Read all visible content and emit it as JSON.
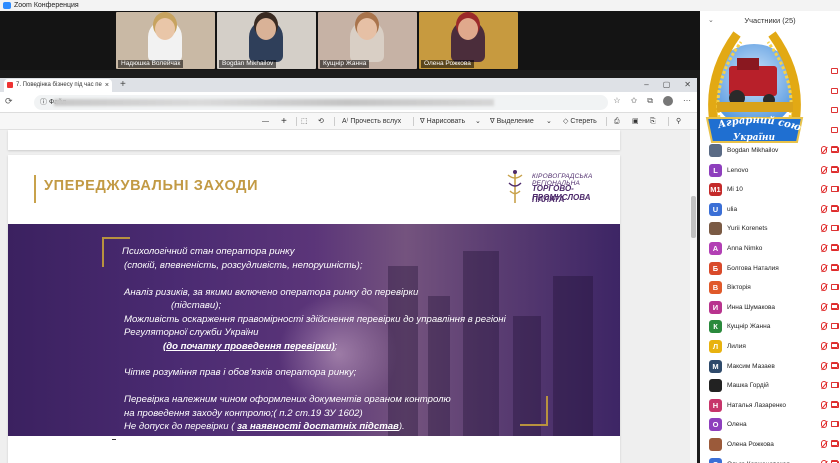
{
  "zoom": {
    "title": "Zoom Конференция"
  },
  "videos": [
    {
      "name": "Надюшка Волейчак",
      "bg": "#c9b9a5",
      "shirt": "#f2f2f2",
      "skin": "#e9c6a8",
      "hair": "#c7a35f"
    },
    {
      "name": "Bogdan Mikhailov",
      "bg": "#d4cfc8",
      "shirt": "#2f3f5a",
      "skin": "#d9b297",
      "hair": "#3a2b22"
    },
    {
      "name": "Кущнір Жанна",
      "bg": "#c6b2a5",
      "shirt": "#d9cfc5",
      "skin": "#e6c0a5",
      "hair": "#a9744c"
    },
    {
      "name": "Олена Рожкова",
      "bg": "#c79a3f",
      "shirt": "#4b2d3b",
      "skin": "#e0a98c",
      "hair": "#9b2a2a"
    }
  ],
  "browser": {
    "tab_title": "7. Поведінка бізнесу під час пе",
    "addr_label": "Файл"
  },
  "pdf_toolbar": {
    "read_aloud": "Прочесть вслух",
    "draw": "Нарисовать",
    "highlight": "Выделение",
    "erase": "Стереть"
  },
  "slide": {
    "heading": "УПЕРЕДЖУВАЛЬНІ ЗАХОДИ",
    "org_line1": "КІРОВОГРАДСЬКА РЕГІОНАЛЬНА",
    "org_line2": "ТОРГОВО-ПРОМИСЛОВА",
    "org_line3": "ПАЛАТА",
    "l1": "Психологічний стан оператора ринку",
    "l2": "(спокій, впевненість, розсудливість, непорушність);",
    "l3": "Аналіз ризиків, за якими включено оператора ринку до перевірки",
    "l4": "(підстави);",
    "l5": "Можливість оскарження правомірності здійснення перевірки до управління в регіоні",
    "l6": "Регуляторної служби України",
    "l7": "(до початку проведення перевірки)",
    "l7_end": ";",
    "l8": "Чітке розуміння прав і обов’язків оператора ринку;",
    "l9": "Перевірка належним чином оформлених документів органом контролю",
    "l10": "на проведення заходу контролю;( п.2 ст.19 ЗУ 1602)",
    "l11": "Не допуск до перевірки ( ",
    "l11_bold": "за наявності достатніх підстав",
    "l11_end": ")."
  },
  "participants": {
    "title": "Участники (25)",
    "list": [
      {
        "name": "Bogdan Mikhailov",
        "initial": "",
        "color": "#5a6b85"
      },
      {
        "name": "Lenovo",
        "initial": "L",
        "color": "#8e3fbd"
      },
      {
        "name": "Mi 10",
        "initial": "M1",
        "color": "#c42a2a"
      },
      {
        "name": "ulia",
        "initial": "U",
        "color": "#3b6fd6"
      },
      {
        "name": "Yurii Korenets",
        "initial": "",
        "color": "#7a5a44"
      },
      {
        "name": "Anna Nimko",
        "initial": "A",
        "color": "#b23fb4"
      },
      {
        "name": "Болгова Наталия",
        "initial": "Б",
        "color": "#d94a2a"
      },
      {
        "name": "Вікторія",
        "initial": "В",
        "color": "#e0592a"
      },
      {
        "name": "Инна Шумакова",
        "initial": "И",
        "color": "#b8338e"
      },
      {
        "name": "Кущнір Жанна",
        "initial": "К",
        "color": "#2a8a3c"
      },
      {
        "name": "Лилия",
        "initial": "Л",
        "color": "#e8b20f"
      },
      {
        "name": "Максим Мазаев",
        "initial": "М",
        "color": "#2e4a6b"
      },
      {
        "name": "Машка Гордій",
        "initial": "",
        "color": "#222222"
      },
      {
        "name": "Наталья Лазаренко",
        "initial": "Н",
        "color": "#c7356b"
      },
      {
        "name": "Олена",
        "initial": "О",
        "color": "#8e3fbd"
      },
      {
        "name": "Олена Рожкова",
        "initial": "",
        "color": "#9b5a3a"
      },
      {
        "name": "Ольга Корженовская",
        "initial": "О",
        "color": "#3b6fd6"
      }
    ]
  },
  "wreath": {
    "line1": "Аграрний союз",
    "line2": "України"
  }
}
